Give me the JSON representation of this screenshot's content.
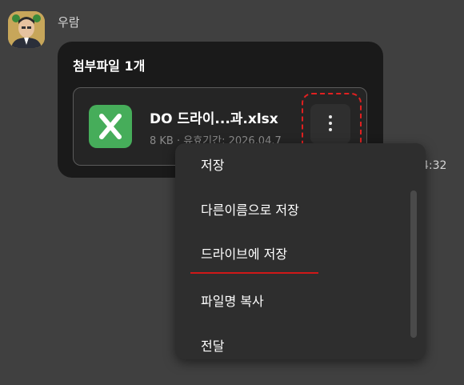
{
  "chat": {
    "sender_name": "우람",
    "message_time": "4:32",
    "attachment_header": "첨부파일 1개",
    "file": {
      "name": "DO 드라이...과.xlsx",
      "meta": "8 KB · 유효기간: 2026.04.7",
      "icon": "excel-icon",
      "icon_color": "#46ad5a"
    }
  },
  "context_menu": {
    "items": [
      {
        "label": "저장"
      },
      {
        "label": "다른이름으로 저장"
      },
      {
        "label": "드라이브에 저장"
      },
      {
        "label": "파일명 복사"
      },
      {
        "label": "전달"
      }
    ]
  },
  "colors": {
    "background": "#404040",
    "bubble": "#1a1a1a",
    "menu": "#2e2e2e",
    "annotation": "#e02020"
  }
}
